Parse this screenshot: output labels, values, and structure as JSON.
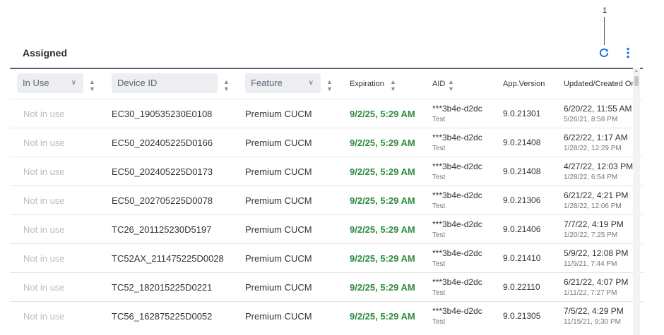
{
  "callout": {
    "number": "1"
  },
  "panel": {
    "title": "Assigned"
  },
  "icons": {
    "refresh": "refresh-icon",
    "more": "more-vertical-icon",
    "accent": "#1a73e8"
  },
  "columns": {
    "in_use": {
      "placeholder": "In Use"
    },
    "device_id": {
      "placeholder": "Device ID"
    },
    "feature": {
      "placeholder": "Feature"
    },
    "expiration": {
      "label": "Expiration"
    },
    "aid": {
      "label": "AID"
    },
    "app_version": {
      "label": "App.Version"
    },
    "updated": {
      "label": "Updated/Created On"
    }
  },
  "rows": [
    {
      "in_use": "Not in use",
      "device_id": "EC30_190535230E0108",
      "feature": "Premium CUCM",
      "expiration": "9/2/25, 5:29 AM",
      "aid": "***3b4e-d2dc",
      "aid_sub": "Test",
      "version": "9.0.21301",
      "updated": "6/20/22, 11:55 AM",
      "created": "5/26/21, 8:58 PM"
    },
    {
      "in_use": "Not in use",
      "device_id": "EC50_202405225D0166",
      "feature": "Premium CUCM",
      "expiration": "9/2/25, 5:29 AM",
      "aid": "***3b4e-d2dc",
      "aid_sub": "Test",
      "version": "9.0.21408",
      "updated": "6/22/22, 1:17 AM",
      "created": "1/28/22, 12:29 PM"
    },
    {
      "in_use": "Not in use",
      "device_id": "EC50_202405225D0173",
      "feature": "Premium CUCM",
      "expiration": "9/2/25, 5:29 AM",
      "aid": "***3b4e-d2dc",
      "aid_sub": "Test",
      "version": "9.0.21408",
      "updated": "4/27/22, 12:03 PM",
      "created": "1/28/22, 6:54 PM"
    },
    {
      "in_use": "Not in use",
      "device_id": "EC50_202705225D0078",
      "feature": "Premium CUCM",
      "expiration": "9/2/25, 5:29 AM",
      "aid": "***3b4e-d2dc",
      "aid_sub": "Test",
      "version": "9.0.21306",
      "updated": "6/21/22, 4:21 PM",
      "created": "1/28/22, 12:06 PM"
    },
    {
      "in_use": "Not in use",
      "device_id": "TC26_201125230D5197",
      "feature": "Premium CUCM",
      "expiration": "9/2/25, 5:29 AM",
      "aid": "***3b4e-d2dc",
      "aid_sub": "Test",
      "version": "9.0.21406",
      "updated": "7/7/22, 4:19 PM",
      "created": "1/20/22, 7:25 PM"
    },
    {
      "in_use": "Not in use",
      "device_id": "TC52AX_211475225D0028",
      "feature": "Premium CUCM",
      "expiration": "9/2/25, 5:29 AM",
      "aid": "***3b4e-d2dc",
      "aid_sub": "Test",
      "version": "9.0.21410",
      "updated": "5/9/22, 12:08 PM",
      "created": "11/9/21, 7:44 PM"
    },
    {
      "in_use": "Not in use",
      "device_id": "TC52_182015225D0221",
      "feature": "Premium CUCM",
      "expiration": "9/2/25, 5:29 AM",
      "aid": "***3b4e-d2dc",
      "aid_sub": "Test",
      "version": "9.0.22110",
      "updated": "6/21/22, 4:07 PM",
      "created": "1/11/22, 7:27 PM"
    },
    {
      "in_use": "Not in use",
      "device_id": "TC56_162875225D0052",
      "feature": "Premium CUCM",
      "expiration": "9/2/25, 5:29 AM",
      "aid": "***3b4e-d2dc",
      "aid_sub": "Test",
      "version": "9.0.21305",
      "updated": "7/5/22, 4:29 PM",
      "created": "11/15/21, 9:30 PM"
    }
  ]
}
